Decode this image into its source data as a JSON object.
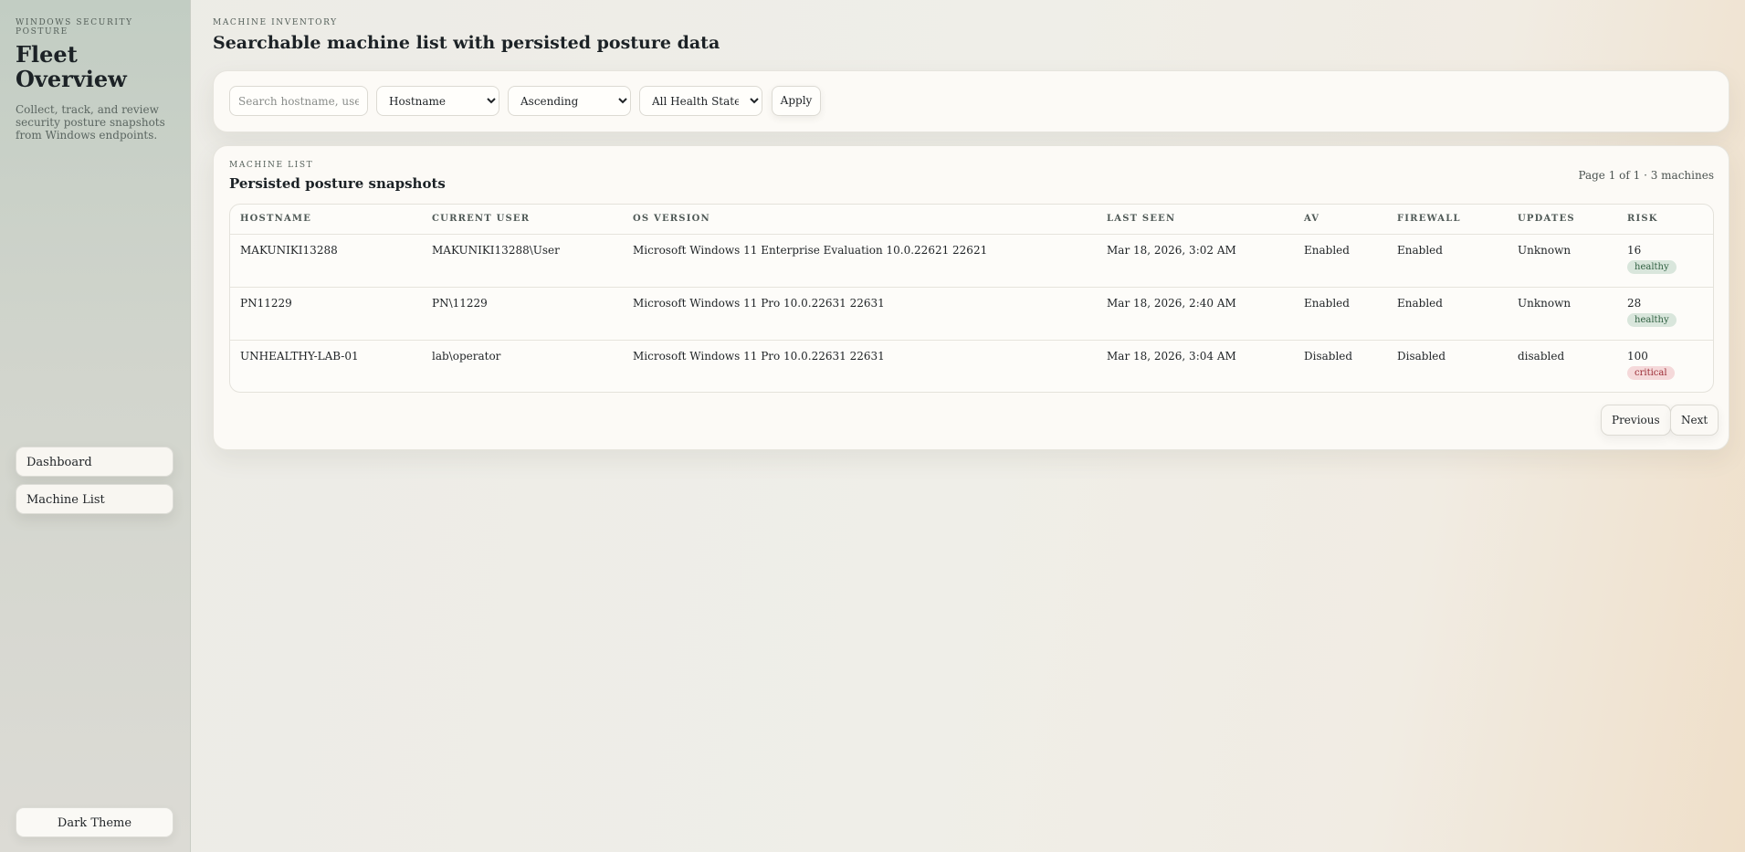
{
  "sidebar": {
    "kicker": "WINDOWS SECURITY POSTURE",
    "title": "Fleet Overview",
    "description": "Collect, track, and review security posture snapshots from Windows endpoints.",
    "nav": [
      {
        "label": "Dashboard"
      },
      {
        "label": "Machine List"
      }
    ],
    "theme_toggle": "Dark Theme"
  },
  "header": {
    "kicker": "MACHINE INVENTORY",
    "title": "Searchable machine list with persisted posture data"
  },
  "filters": {
    "search_placeholder": "Search hostname, user, d",
    "search_value": "",
    "sort_field": "Hostname",
    "sort_order": "Ascending",
    "health_filter": "All Health States",
    "apply_label": "Apply"
  },
  "list": {
    "kicker": "MACHINE LIST",
    "title": "Persisted posture snapshots",
    "page_info": "Page 1 of 1 · 3 machines",
    "columns": [
      "HOSTNAME",
      "CURRENT USER",
      "OS VERSION",
      "LAST SEEN",
      "AV",
      "FIREWALL",
      "UPDATES",
      "RISK"
    ],
    "rows": [
      {
        "hostname": "MAKUNIKI13288",
        "user": "MAKUNIKI13288\\User",
        "os": "Microsoft Windows 11 Enterprise Evaluation 10.0.22621 22621",
        "last_seen": "Mar 18, 2026, 3:02 AM",
        "av": "Enabled",
        "firewall": "Enabled",
        "updates": "Unknown",
        "risk": "16",
        "health": "healthy"
      },
      {
        "hostname": "PN11229",
        "user": "PN\\11229",
        "os": "Microsoft Windows 11 Pro 10.0.22631 22631",
        "last_seen": "Mar 18, 2026, 2:40 AM",
        "av": "Enabled",
        "firewall": "Enabled",
        "updates": "Unknown",
        "risk": "28",
        "health": "healthy"
      },
      {
        "hostname": "UNHEALTHY-LAB-01",
        "user": "lab\\operator",
        "os": "Microsoft Windows 11 Pro 10.0.22631 22631",
        "last_seen": "Mar 18, 2026, 3:04 AM",
        "av": "Disabled",
        "firewall": "Disabled",
        "updates": "disabled",
        "risk": "100",
        "health": "critical"
      }
    ],
    "previous_label": "Previous",
    "next_label": "Next"
  },
  "colors": {
    "healthy_badge": "#d9e6dc",
    "critical_badge": "#f5d9da"
  }
}
